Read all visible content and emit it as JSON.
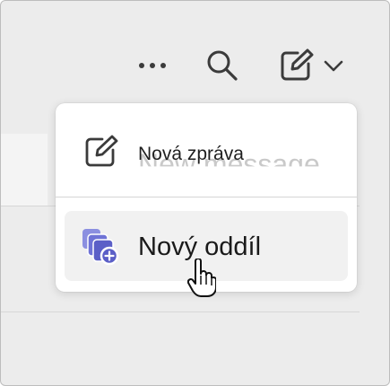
{
  "toolbar": {
    "more_icon": "more-horizontal-icon",
    "search_icon": "search-icon",
    "compose_icon": "compose-icon",
    "dropdown_icon": "chevron-down-icon"
  },
  "menu": {
    "items": [
      {
        "label": "Nová zpráva",
        "ghost_label": "New message",
        "icon": "compose-icon"
      },
      {
        "label": "Nový oddíl",
        "icon": "new-section-icon",
        "hovered": true
      }
    ]
  },
  "colors": {
    "background": "#ececec",
    "menu_background": "#ffffff",
    "hover_background": "#f1f1f1",
    "icon_dark": "#3b3b3b",
    "accent_purple": "#5b5fc7",
    "accent_purple_light": "#8b8fe0"
  }
}
